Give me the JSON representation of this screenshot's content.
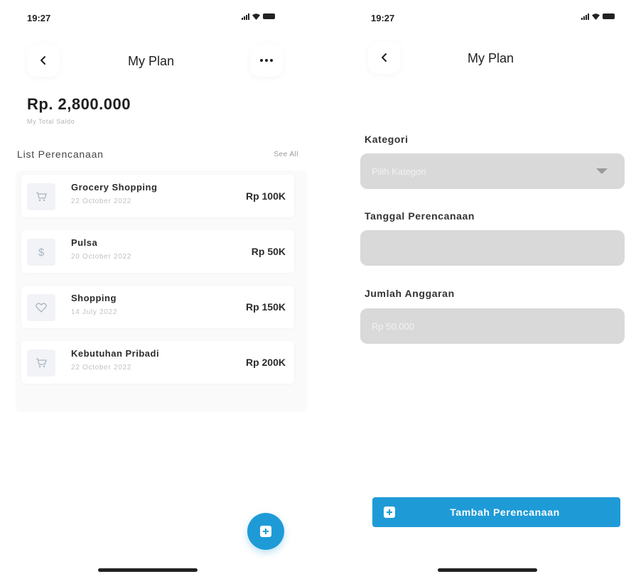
{
  "left": {
    "status_time": "19:27",
    "title": "My Plan",
    "balance": "Rp. 2,800.000",
    "balance_label": "My Total Saldo",
    "section_title": "List Perencanaan",
    "see_all": "See All",
    "plans": [
      {
        "name": "Grocery Shopping",
        "date": "22 October 2022",
        "amount": "Rp 100K",
        "icon": "cart-icon"
      },
      {
        "name": "Pulsa",
        "date": "20 October 2022",
        "amount": "Rp 50K",
        "icon": "dollar-icon"
      },
      {
        "name": "Shopping",
        "date": "14 July 2022",
        "amount": "Rp 150K",
        "icon": "heart-icon"
      },
      {
        "name": "Kebutuhan Pribadi",
        "date": "22 October 2022",
        "amount": "Rp 200K",
        "icon": "cart-icon"
      }
    ]
  },
  "right": {
    "status_time": "19:27",
    "title": "My Plan",
    "fields": {
      "kategori_label": "Kategori",
      "kategori_placeholder": "Pilih Kategori",
      "tanggal_label": "Tanggal Perencanaan",
      "tanggal_value": "",
      "jumlah_label": "Jumlah Anggaran",
      "jumlah_placeholder": "Rp 50.000"
    },
    "submit_label": "Tambah Perencanaan"
  },
  "colors": {
    "accent": "#1e9bd7",
    "field_bg": "#d9d9d9",
    "icon_tint": "#a8b4c4"
  }
}
